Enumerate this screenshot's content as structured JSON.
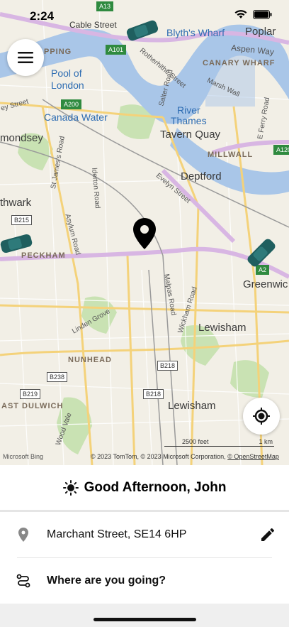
{
  "status_bar": {
    "time": "2:24"
  },
  "map": {
    "place_labels": [
      {
        "text": "Cable Street",
        "cls": "road"
      },
      {
        "text": "Blyth's Wharf",
        "cls": "blue"
      },
      {
        "text": "Poplar",
        "cls": ""
      },
      {
        "text": "Aspen Way",
        "cls": "road"
      },
      {
        "text": "PPING",
        "cls": "dist"
      },
      {
        "text": "Rotherhithe Street",
        "cls": "road"
      },
      {
        "text": "CANARY WHARF",
        "cls": "dist"
      },
      {
        "text": "Pool of",
        "cls": "blue"
      },
      {
        "text": "London",
        "cls": "blue"
      },
      {
        "text": "Marsh Wall",
        "cls": "road"
      },
      {
        "text": "ey Street",
        "cls": "road"
      },
      {
        "text": "Canada Water",
        "cls": "blue"
      },
      {
        "text": "River",
        "cls": "blue"
      },
      {
        "text": "Thames",
        "cls": "blue"
      },
      {
        "text": "Tavern Quay",
        "cls": ""
      },
      {
        "text": "mondsey",
        "cls": ""
      },
      {
        "text": "MILLWALL",
        "cls": "dist"
      },
      {
        "text": "Deptford",
        "cls": ""
      },
      {
        "text": "thwark",
        "cls": ""
      },
      {
        "text": "PECKHAM",
        "cls": "dist"
      },
      {
        "text": "Greenwic",
        "cls": ""
      },
      {
        "text": "Lewisham",
        "cls": ""
      },
      {
        "text": "NUNHEAD",
        "cls": "dist"
      },
      {
        "text": "AST DULWICH",
        "cls": "dist"
      },
      {
        "text": "Lewisham",
        "cls": ""
      },
      {
        "text": "Evelyn Street",
        "cls": "road"
      },
      {
        "text": "Asylum Road",
        "cls": "road"
      },
      {
        "text": "Malpas Road",
        "cls": "road"
      },
      {
        "text": "Wickham Road",
        "cls": "road"
      },
      {
        "text": "Linden Grove",
        "cls": "road"
      },
      {
        "text": "Wood Vale",
        "cls": "road"
      },
      {
        "text": "St James's Road",
        "cls": "road"
      },
      {
        "text": "lderton Road",
        "cls": "road"
      },
      {
        "text": "Salter Road",
        "cls": "road"
      },
      {
        "text": "E Ferry Road",
        "cls": "road"
      }
    ],
    "shields": [
      {
        "text": "A13",
        "green": true
      },
      {
        "text": "A101",
        "green": true
      },
      {
        "text": "A200",
        "green": true
      },
      {
        "text": "A120",
        "green": true
      },
      {
        "text": "B215",
        "green": false
      },
      {
        "text": "B218",
        "green": false
      },
      {
        "text": "B238",
        "green": false
      },
      {
        "text": "B219",
        "green": false
      },
      {
        "text": "B218",
        "green": false
      },
      {
        "text": "A2",
        "green": true
      }
    ],
    "attribution": "© 2023 TomTom, © 2023 Microsoft Corporation,",
    "attribution_link": "© OpenStreetMap",
    "scale_feet": "2500 feet",
    "scale_km": "1 km",
    "logo_text": "Microsoft Bing"
  },
  "panel": {
    "greeting": "Good Afternoon, John",
    "pickup_address": "Marchant Street, SE14 6HP",
    "destination_prompt": "Where are you going?"
  },
  "colors": {
    "land": "#f2efe6",
    "water": "#a9c6e8",
    "major_road": "#d8b6e3",
    "road_yellow": "#f4d27a",
    "park": "#c9e2b3",
    "car": "#1f5f5f"
  }
}
